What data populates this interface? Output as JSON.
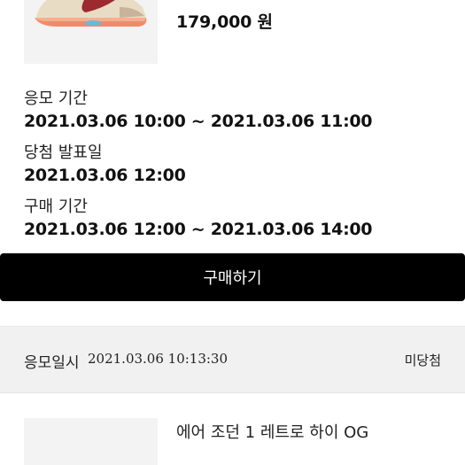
{
  "product_top": {
    "price": "179,000 원",
    "image_icon": "sneaker-image"
  },
  "info": {
    "entry_period_label": "응모 기간",
    "entry_period_value": "2021.03.06 10:00 ~ 2021.03.06 11:00",
    "announce_label": "당첨 발표일",
    "announce_value": "2021.03.06 12:00",
    "purchase_period_label": "구매 기간",
    "purchase_period_value": "2021.03.06 12:00 ~ 2021.03.06 14:00"
  },
  "buy_button": {
    "label": "구매하기"
  },
  "entry_record": {
    "label": "응모일시",
    "datetime": "2021.03.06 10:13:30",
    "status": "미당첨"
  },
  "product_bottom": {
    "name": "에어 조던 1 레트로 하이 OG"
  },
  "colors": {
    "button_bg": "#000000",
    "section_bg": "#f1f1f1"
  }
}
